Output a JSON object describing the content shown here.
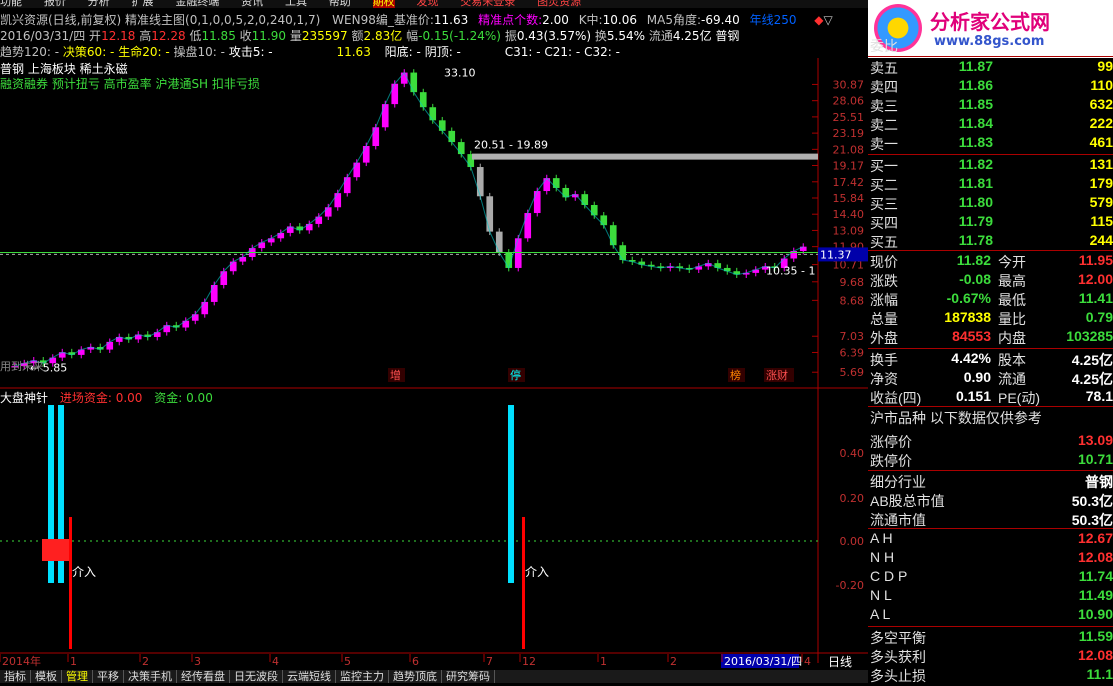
{
  "menubar": {
    "items": [
      "功能",
      "报价",
      "分析",
      "扩展",
      "金融终端",
      "资讯",
      "工具",
      "帮助",
      "期权",
      "发现",
      "交易未登录",
      "图灵资源"
    ]
  },
  "header": {
    "line1": {
      "stock": "凯兴资源(日线,前复权)",
      "indicator": "精准线主图(0,1,0,0,5,2,0,240,1,7)",
      "wen": "WEN98编_基准价:",
      "base_price": "11.63",
      "accurate_label": "精准点个数:",
      "accurate_value": "2.00",
      "k_label": "K中:",
      "k_value": "10.06",
      "ma5_label": "MA5角度:",
      "ma5_value": "-69.40",
      "ma250_label": "年线250"
    },
    "line2": {
      "date": "2016/03/31/四",
      "open_l": "开",
      "open": "12.18",
      "high_l": "高",
      "high": "12.28",
      "low_l": "低",
      "low": "11.85",
      "close_l": "收",
      "close": "11.90",
      "vol_l": "量",
      "vol": "235597",
      "amt_l": "额",
      "amt": "2.83亿",
      "chg_l": "幅",
      "chg": "-0.15(-1.24%)",
      "amp_l": "振",
      "amp": "0.43(3.57%)",
      "turn_l": "换",
      "turn": "5.54%",
      "float_l": "流通",
      "float": "4.25亿",
      "name": "普钢"
    },
    "line3": {
      "trend": "趋势120: -",
      "decide": "决策60: -",
      "life": "生命20: -",
      "op": "操盘10: -",
      "attack": "攻击5: -",
      "v1": "11.63",
      "yangdi": "阳底: -",
      "yinding": "阴顶: -",
      "c31": "C31: -",
      "c21": "C21: -",
      "c32": "C32: -"
    }
  },
  "chart": {
    "concept1": "普钢    上海板块  稀土永磁",
    "concept2": "融资融券 预计扭亏 高市盈率 沪港通SH 扣非亏损",
    "price_ticks": [
      "30.87",
      "28.06",
      "25.51",
      "23.19",
      "21.08",
      "19.17",
      "17.42",
      "15.84",
      "14.40",
      "13.09",
      "11.90",
      "10.71",
      "9.68",
      "8.68",
      "7.03",
      "6.39",
      "5.69"
    ],
    "current_tag": "11.37",
    "peak_label": "33.10",
    "low_label": "5.85",
    "box_label": "20.51 - 19.89",
    "support_label": "10.35 - 1",
    "hint": "用到未来",
    "events": [
      "增",
      "停",
      "榜",
      "涨财"
    ],
    "candles": [
      5.9,
      6.0,
      6.1,
      6.0,
      6.2,
      6.4,
      6.3,
      6.5,
      6.6,
      6.5,
      6.8,
      7.0,
      6.9,
      7.1,
      7.0,
      7.2,
      7.5,
      7.4,
      7.7,
      8.0,
      8.6,
      9.5,
      10.3,
      10.9,
      11.2,
      11.8,
      12.2,
      12.5,
      12.9,
      13.4,
      13.1,
      13.6,
      14.2,
      15.0,
      16.3,
      17.9,
      19.5,
      21.5,
      24.0,
      27.5,
      31.0,
      33.1,
      29.5,
      27.0,
      25.0,
      23.5,
      22.0,
      20.5,
      19.0,
      16.0,
      13.0,
      11.5,
      10.5,
      12.5,
      14.5,
      16.5,
      17.8,
      16.8,
      15.9,
      16.2,
      15.2,
      14.3,
      13.5,
      12.0,
      11.0,
      10.9,
      10.7,
      10.6,
      10.5,
      10.6,
      10.5,
      10.4,
      10.6,
      10.8,
      10.5,
      10.3,
      10.1,
      10.2,
      10.4,
      10.6,
      10.5,
      11.1,
      11.6,
      11.9
    ]
  },
  "sub": {
    "title": "大盘神针",
    "inflow_label": "进场资金: 0.00",
    "fund_label": "资金: 0.00",
    "ticks": [
      "0.40",
      "0.20",
      "0.00",
      "-0.20"
    ],
    "signal": "介入"
  },
  "timeline": {
    "labels": [
      "2014年",
      "1",
      "2",
      "3",
      "4",
      "5",
      "6",
      "7",
      "12",
      "1",
      "2",
      "2016/03/31/四",
      "4"
    ],
    "period": "日线"
  },
  "bottom_tabs": [
    "指标",
    "模板",
    "管理",
    "平移",
    "决策手机",
    "经传看盘",
    "日无波段",
    "云端短线",
    "监控主力",
    "趋势顶底",
    "研究筹码"
  ],
  "logo": {
    "title": "分析家公式网",
    "url": "www.88gs.com"
  },
  "panel": {
    "weibi": "委比",
    "sell": [
      {
        "label": "卖五",
        "price": "11.87",
        "vol": "99"
      },
      {
        "label": "卖四",
        "price": "11.86",
        "vol": "110"
      },
      {
        "label": "卖三",
        "price": "11.85",
        "vol": "632"
      },
      {
        "label": "卖二",
        "price": "11.84",
        "vol": "222"
      },
      {
        "label": "卖一",
        "price": "11.83",
        "vol": "461"
      }
    ],
    "buy": [
      {
        "label": "买一",
        "price": "11.82",
        "vol": "131"
      },
      {
        "label": "买二",
        "price": "11.81",
        "vol": "179"
      },
      {
        "label": "买三",
        "price": "11.80",
        "vol": "579"
      },
      {
        "label": "买四",
        "price": "11.79",
        "vol": "115"
      },
      {
        "label": "买五",
        "price": "11.78",
        "vol": "244"
      }
    ],
    "stats": [
      {
        "l1": "现价",
        "v1": "11.82",
        "c1": "#3cdc3c",
        "l2": "今开",
        "v2": "11.95",
        "c2": "#ff3030"
      },
      {
        "l1": "涨跌",
        "v1": "-0.08",
        "c1": "#3cdc3c",
        "l2": "最高",
        "v2": "12.00",
        "c2": "#ff3030"
      },
      {
        "l1": "涨幅",
        "v1": "-0.67%",
        "c1": "#3cdc3c",
        "l2": "最低",
        "v2": "11.41",
        "c2": "#3cdc3c"
      },
      {
        "l1": "总量",
        "v1": "187838",
        "c1": "#ffff00",
        "l2": "量比",
        "v2": "0.79",
        "c2": "#3cdc3c"
      },
      {
        "l1": "外盘",
        "v1": "84553",
        "c1": "#ff3030",
        "l2": "内盘",
        "v2": "103285",
        "c2": "#3cdc3c"
      }
    ],
    "stats2": [
      {
        "l1": "换手",
        "v1": "4.42%",
        "l2": "股本",
        "v2": "4.25亿"
      },
      {
        "l1": "净资",
        "v1": "0.90",
        "l2": "流通",
        "v2": "4.25亿"
      },
      {
        "l1": "收益(四)",
        "v1": "0.151",
        "l2": "PE(动)",
        "v2": "78.1"
      }
    ],
    "hu_title": "沪市品种  以下数据仅供参考",
    "limit_up_l": "涨停价",
    "limit_up": "13.09",
    "limit_dn_l": "跌停价",
    "limit_dn": "10.71",
    "industry_l": "细分行业",
    "industry": "普钢",
    "ab_l": "AB股总市值",
    "ab": "50.3亿",
    "float_mv_l": "流通市值",
    "float_mv": "50.3亿",
    "lines": [
      {
        "l": "A H",
        "v": "12.67",
        "c": "#ff3030"
      },
      {
        "l": "N H",
        "v": "12.08",
        "c": "#ff3030"
      },
      {
        "l": "C D P",
        "v": "11.74",
        "c": "#3cdc3c"
      },
      {
        "l": "N L",
        "v": "11.49",
        "c": "#3cdc3c"
      },
      {
        "l": "A L",
        "v": "10.90",
        "c": "#3cdc3c"
      }
    ],
    "bull": [
      {
        "l": "多空平衡",
        "v": "11.59",
        "c": "#3cdc3c"
      },
      {
        "l": "多头获利",
        "v": "12.08",
        "c": "#ff3030"
      },
      {
        "l": "多头止损",
        "v": "11.1",
        "c": "#3cdc3c"
      }
    ]
  }
}
